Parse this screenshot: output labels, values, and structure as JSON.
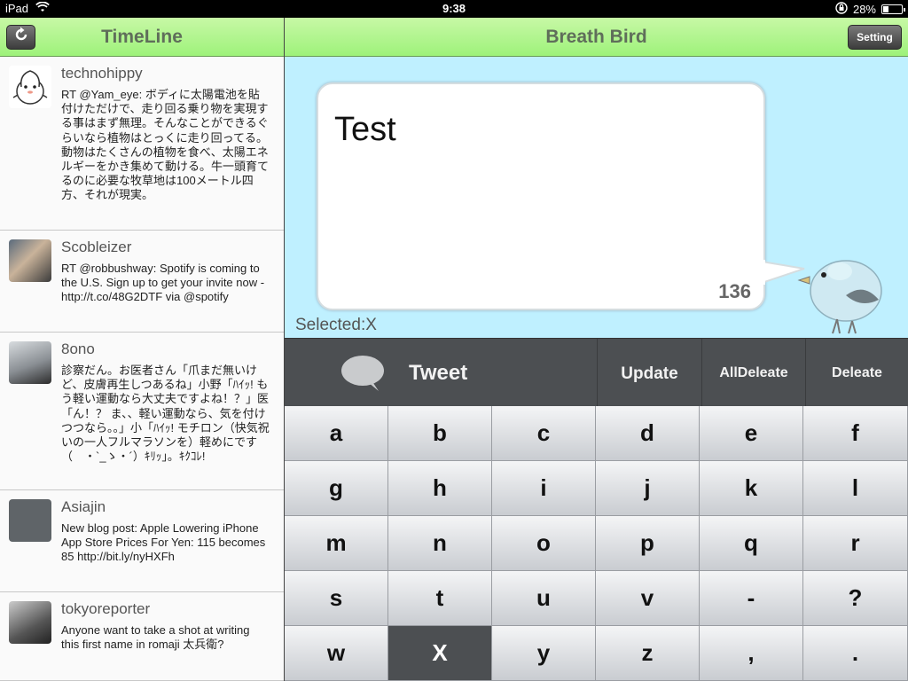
{
  "status_bar": {
    "device": "iPad",
    "time": "9:38",
    "battery": "28%",
    "battery_level": 0.28
  },
  "timeline": {
    "title": "TimeLine",
    "tweets": [
      {
        "user": "technohippy",
        "text": "RT @Yam_eye: ボディに太陽電池を貼付けただけで、走り回る乗り物を実現する事はまず無理。そんなことができるぐらいなら植物はとっくに走り回ってる。動物はたくさんの植物を食べ、太陽エネルギーをかき集めて動ける。牛一頭育てるのに必要な牧草地は100メートル四方、それが現実。"
      },
      {
        "user": "Scobleizer",
        "text": "RT @robbushway: Spotify is coming to the U.S. Sign up to get your invite now - http://t.co/48G2DTF via @spotify"
      },
      {
        "user": "8ono",
        "text": "診察だん。お医者さん「爪まだ無いけど、皮膚再生しつあるね」小野「ﾊｲｯ! もう軽い運動なら大丈夫ですよね！？」医「ん！？ ま、、軽い運動なら、気を付けつつなら。。」小「ﾊｲｯ! モチロン（快気祝いの一人フルマラソンを）軽めにです（　・`_ゝ・´）ｷﾘｯ」。ｷｸｺﾚ!"
      },
      {
        "user": "Asiajin",
        "text": "New blog post: Apple Lowering iPhone App Store Prices For Yen: 115 becomes 85 http://bit.ly/nyHXFh"
      },
      {
        "user": "tokyoreporter",
        "text": "Anyone want to take a shot at writing this first name in romaji 太兵衛?"
      }
    ]
  },
  "composer": {
    "title": "Breath Bird",
    "setting_label": "Setting",
    "tweet_text": "Test",
    "char_count": "136",
    "selected_label": "Selected:X"
  },
  "actions": {
    "tweet": "Tweet",
    "update": "Update",
    "all_delete": "AllDeleate",
    "delete": "Deleate"
  },
  "keyboard": {
    "keys": [
      "a",
      "b",
      "c",
      "d",
      "e",
      "f",
      "g",
      "h",
      "i",
      "j",
      "k",
      "l",
      "m",
      "n",
      "o",
      "p",
      "q",
      "r",
      "s",
      "t",
      "u",
      "v",
      "-",
      "?",
      "w",
      "X",
      "y",
      "z",
      ",",
      "."
    ],
    "selected_key": "X"
  },
  "colors": {
    "header_green": "#9ef27a",
    "sky_blue": "#bff0ff",
    "action_bar": "#4c4f52"
  }
}
